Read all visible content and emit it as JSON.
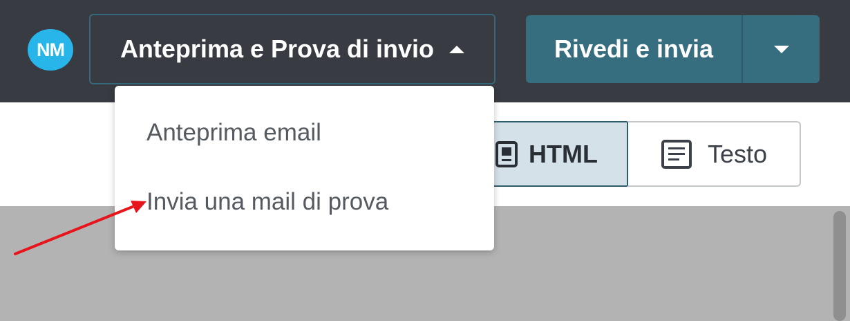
{
  "header": {
    "avatar_initials": "NM",
    "preview_button_label": "Anteprima e Prova di invio",
    "review_button_label": "Rivedi e invia"
  },
  "dropdown": {
    "items": [
      {
        "label": "Anteprima email"
      },
      {
        "label": "Invia una mail di prova"
      }
    ]
  },
  "view_toggle": {
    "html_label": "HTML",
    "text_label": "Testo",
    "selected": "HTML"
  },
  "icons": {
    "preview_caret": "caret-up-icon",
    "review_caret": "caret-down-icon",
    "html_view": "html-icon",
    "text_view": "text-document-icon"
  },
  "annotation": {
    "color": "#e8141b"
  }
}
